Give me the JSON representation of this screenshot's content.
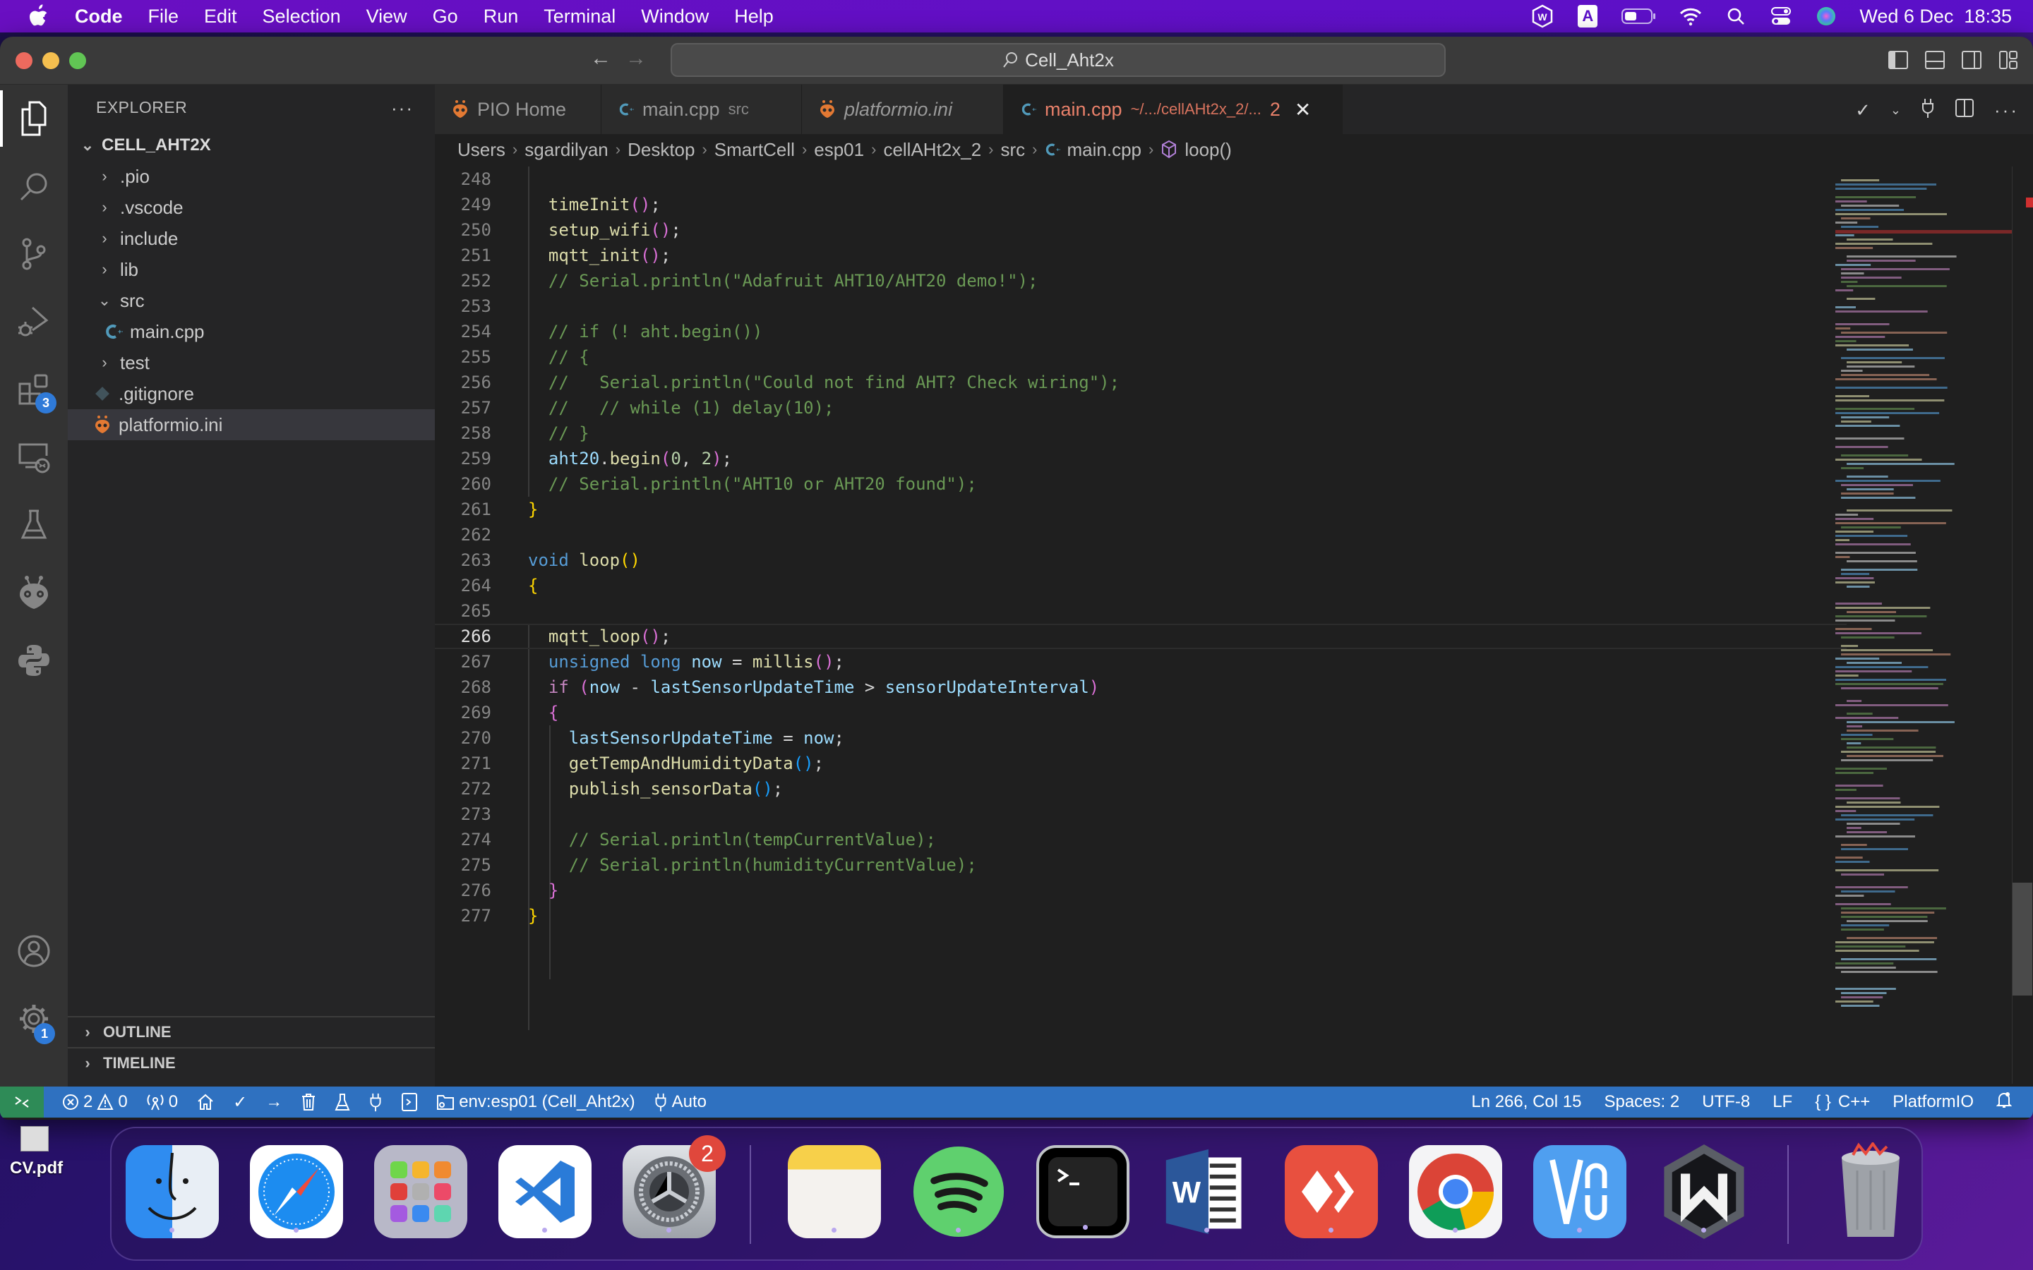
{
  "menubar": {
    "app_name": "Code",
    "items": [
      "File",
      "Edit",
      "Selection",
      "View",
      "Go",
      "Run",
      "Terminal",
      "Window",
      "Help"
    ],
    "status_icons": [
      "warp-w-icon",
      "input-source-icon",
      "battery-icon",
      "wifi-icon",
      "spotlight-search-icon",
      "control-center-icon",
      "siri-icon"
    ],
    "input_source_label": "A",
    "clock": "Wed 6 Dec  18:35"
  },
  "window": {
    "command_center_text": "Cell_Aht2x"
  },
  "activity_bar": {
    "items": [
      {
        "name": "explorer",
        "active": true
      },
      {
        "name": "search"
      },
      {
        "name": "source-control"
      },
      {
        "name": "run-debug"
      },
      {
        "name": "extensions",
        "badge": "3"
      },
      {
        "name": "remote-explorer"
      },
      {
        "name": "testing"
      },
      {
        "name": "platformio"
      },
      {
        "name": "python"
      }
    ],
    "bottom": [
      {
        "name": "accounts"
      },
      {
        "name": "manage",
        "badge": "1"
      }
    ]
  },
  "sidebar": {
    "title": "EXPLORER",
    "root": "CELL_AHT2X",
    "tree": [
      {
        "label": ".pio",
        "type": "folder",
        "expanded": false,
        "depth": 1
      },
      {
        "label": ".vscode",
        "type": "folder",
        "expanded": false,
        "depth": 1
      },
      {
        "label": "include",
        "type": "folder",
        "expanded": false,
        "depth": 1
      },
      {
        "label": "lib",
        "type": "folder",
        "expanded": false,
        "depth": 1
      },
      {
        "label": "src",
        "type": "folder",
        "expanded": true,
        "depth": 1
      },
      {
        "label": "main.cpp",
        "type": "cpp",
        "depth": 2
      },
      {
        "label": "test",
        "type": "folder",
        "expanded": false,
        "depth": 1
      },
      {
        "label": ".gitignore",
        "type": "git",
        "depth": 1
      },
      {
        "label": "platformio.ini",
        "type": "pio",
        "depth": 1,
        "selected": true
      }
    ],
    "sections": [
      "OUTLINE",
      "TIMELINE"
    ]
  },
  "tabs": [
    {
      "label": "PIO Home",
      "icon": "platformio",
      "active": false
    },
    {
      "label": "main.cpp",
      "description": "src",
      "icon": "cpp",
      "active": false
    },
    {
      "label": "platformio.ini",
      "icon": "platformio",
      "italic": true,
      "active": false
    },
    {
      "label": "main.cpp",
      "description": "~/.../cellAHt2x_2/...",
      "count": "2",
      "icon": "cpp",
      "active": true
    }
  ],
  "breadcrumbs": [
    "Users",
    "sgardilyan",
    "Desktop",
    "SmartCell",
    "esp01",
    "cellAHt2x_2",
    "src",
    "main.cpp",
    "loop()"
  ],
  "editor": {
    "current_line": 266,
    "lines": [
      {
        "n": 248,
        "tokens": []
      },
      {
        "n": 249,
        "tokens": [
          [
            "  ",
            ""
          ],
          [
            "timeInit",
            "fn"
          ],
          [
            "(",
            "p2"
          ],
          [
            ")",
            "p2"
          ],
          [
            ";",
            "op"
          ]
        ]
      },
      {
        "n": 250,
        "tokens": [
          [
            "  ",
            ""
          ],
          [
            "setup_wifi",
            "fn"
          ],
          [
            "(",
            "p2"
          ],
          [
            ")",
            "p2"
          ],
          [
            ";",
            "op"
          ]
        ]
      },
      {
        "n": 251,
        "tokens": [
          [
            "  ",
            ""
          ],
          [
            "mqtt_init",
            "fn"
          ],
          [
            "(",
            "p2"
          ],
          [
            ")",
            "p2"
          ],
          [
            ";",
            "op"
          ]
        ]
      },
      {
        "n": 252,
        "tokens": [
          [
            "  ",
            ""
          ],
          [
            "// Serial.println(\"Adafruit AHT10/AHT20 demo!\");",
            "cm"
          ]
        ]
      },
      {
        "n": 253,
        "tokens": []
      },
      {
        "n": 254,
        "tokens": [
          [
            "  ",
            ""
          ],
          [
            "// if (! aht.begin())",
            "cm"
          ]
        ]
      },
      {
        "n": 255,
        "tokens": [
          [
            "  ",
            ""
          ],
          [
            "// {",
            "cm"
          ]
        ]
      },
      {
        "n": 256,
        "tokens": [
          [
            "  ",
            ""
          ],
          [
            "//   Serial.println(\"Could not find AHT? Check wiring\");",
            "cm"
          ]
        ]
      },
      {
        "n": 257,
        "tokens": [
          [
            "  ",
            ""
          ],
          [
            "//   // while (1) delay(10);",
            "cm"
          ]
        ]
      },
      {
        "n": 258,
        "tokens": [
          [
            "  ",
            ""
          ],
          [
            "// }",
            "cm"
          ]
        ]
      },
      {
        "n": 259,
        "tokens": [
          [
            "  ",
            ""
          ],
          [
            "aht20",
            "var"
          ],
          [
            ".",
            "op"
          ],
          [
            "begin",
            "fn"
          ],
          [
            "(",
            "p2"
          ],
          [
            "0",
            "num"
          ],
          [
            ", ",
            "op"
          ],
          [
            "2",
            "num"
          ],
          [
            ")",
            "p2"
          ],
          [
            ";",
            "op"
          ]
        ]
      },
      {
        "n": 260,
        "tokens": [
          [
            "  ",
            ""
          ],
          [
            "// Serial.println(\"AHT10 or AHT20 found\");",
            "cm"
          ]
        ]
      },
      {
        "n": 261,
        "tokens": [
          [
            "}",
            "p1"
          ]
        ]
      },
      {
        "n": 262,
        "tokens": []
      },
      {
        "n": 263,
        "tokens": [
          [
            "void",
            "kw"
          ],
          [
            " ",
            ""
          ],
          [
            "loop",
            "fn"
          ],
          [
            "(",
            "p1"
          ],
          [
            ")",
            "p1"
          ]
        ]
      },
      {
        "n": 264,
        "tokens": [
          [
            "{",
            "p1"
          ]
        ]
      },
      {
        "n": 265,
        "tokens": []
      },
      {
        "n": 266,
        "tokens": [
          [
            "  ",
            ""
          ],
          [
            "mqtt_loop",
            "fn"
          ],
          [
            "(",
            "p2"
          ],
          [
            ")",
            "p2"
          ],
          [
            ";",
            "op"
          ]
        ]
      },
      {
        "n": 267,
        "tokens": [
          [
            "  ",
            ""
          ],
          [
            "unsigned",
            "kw"
          ],
          [
            " ",
            ""
          ],
          [
            "long",
            "kw"
          ],
          [
            " ",
            ""
          ],
          [
            "now",
            "var"
          ],
          [
            " = ",
            "op"
          ],
          [
            "millis",
            "fn"
          ],
          [
            "(",
            "p2"
          ],
          [
            ")",
            "p2"
          ],
          [
            ";",
            "op"
          ]
        ]
      },
      {
        "n": 268,
        "tokens": [
          [
            "  ",
            ""
          ],
          [
            "if",
            "ctl"
          ],
          [
            " ",
            ""
          ],
          [
            "(",
            "p2"
          ],
          [
            "now",
            "var"
          ],
          [
            " - ",
            "op"
          ],
          [
            "lastSensorUpdateTime",
            "var"
          ],
          [
            " > ",
            "op"
          ],
          [
            "sensorUpdateInterval",
            "var"
          ],
          [
            ")",
            "p2"
          ]
        ]
      },
      {
        "n": 269,
        "tokens": [
          [
            "  ",
            ""
          ],
          [
            "{",
            "p2"
          ]
        ]
      },
      {
        "n": 270,
        "tokens": [
          [
            "    ",
            ""
          ],
          [
            "lastSensorUpdateTime",
            "var"
          ],
          [
            " = ",
            "op"
          ],
          [
            "now",
            "var"
          ],
          [
            ";",
            "op"
          ]
        ]
      },
      {
        "n": 271,
        "tokens": [
          [
            "    ",
            ""
          ],
          [
            "getTempAndHumidityData",
            "fn"
          ],
          [
            "(",
            "p3"
          ],
          [
            ")",
            "p3"
          ],
          [
            ";",
            "op"
          ]
        ]
      },
      {
        "n": 272,
        "tokens": [
          [
            "    ",
            ""
          ],
          [
            "publish_sensorData",
            "fn"
          ],
          [
            "(",
            "p3"
          ],
          [
            ")",
            "p3"
          ],
          [
            ";",
            "op"
          ]
        ]
      },
      {
        "n": 273,
        "tokens": []
      },
      {
        "n": 274,
        "tokens": [
          [
            "    ",
            ""
          ],
          [
            "// Serial.println(tempCurrentValue);",
            "cm"
          ]
        ]
      },
      {
        "n": 275,
        "tokens": [
          [
            "    ",
            ""
          ],
          [
            "// Serial.println(humidityCurrentValue);",
            "cm"
          ]
        ]
      },
      {
        "n": 276,
        "tokens": [
          [
            "  ",
            ""
          ],
          [
            "}",
            "p2"
          ]
        ]
      },
      {
        "n": 277,
        "tokens": [
          [
            "}",
            "p1"
          ]
        ]
      }
    ],
    "scroll_position_fraction": 0.89
  },
  "statusbar": {
    "errors": "2",
    "warnings": "0",
    "ports": "0",
    "env": "env:esp01 (Cell_Aht2x)",
    "upload_port": "Auto",
    "cursor": "Ln 266, Col 15",
    "indent": "Spaces: 2",
    "encoding": "UTF-8",
    "eol": "LF",
    "language": "C++",
    "platform": "PlatformIO"
  },
  "desktop": {
    "file": "CV.pdf"
  },
  "dock": {
    "apps": [
      {
        "name": "finder",
        "running": true
      },
      {
        "name": "safari",
        "running": true
      },
      {
        "name": "launchpad",
        "running": false
      },
      {
        "name": "vscode",
        "running": true
      },
      {
        "name": "system-settings",
        "running": true,
        "badge": "2"
      },
      {
        "name": "notes",
        "running": true
      },
      {
        "name": "spotify",
        "running": true
      },
      {
        "name": "terminal",
        "running": true
      },
      {
        "name": "word",
        "running": true
      },
      {
        "name": "anydesk",
        "running": true
      },
      {
        "name": "chrome",
        "running": true
      },
      {
        "name": "vnc-viewer",
        "running": true
      },
      {
        "name": "warp-vpn",
        "running": true
      },
      {
        "name": "trash",
        "running": false
      }
    ]
  }
}
